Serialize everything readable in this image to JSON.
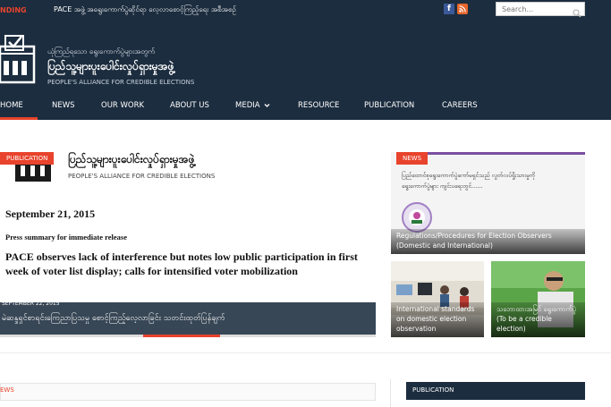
{
  "topbar": {
    "trending_label": "NDING",
    "ticker_text": "PACE အဖွဲ့ အရွေးကောက်ပွဲဆိုင်ရာ လေ့လာစောင့်ကြည့်ရေး အစီအစဉ်",
    "search_placeholder": "Search...",
    "social": [
      "facebook-icon",
      "rss-icon"
    ]
  },
  "header": {
    "logo_line1": "ယုံကြည်ရသော ရွေးကောက်ပွဲများအတွက်",
    "logo_line2": "ပြည်သူ့များပူးပေါင်းလှုပ်ရှားမှုအဖွဲ့",
    "logo_line3": "PEOPLE'S ALLIANCE FOR CREDIBLE ELECTIONS"
  },
  "nav": {
    "items": [
      "HOME",
      "NEWS",
      "OUR WORK",
      "ABOUT US",
      "MEDIA",
      "RESOURCE",
      "PUBLICATION",
      "CAREERS"
    ],
    "media_has_dropdown": true,
    "active": "HOME"
  },
  "feature": {
    "badge": "PUBLICATION",
    "doc_org_mm": "ပြည်သူ့များပူးပေါင်းလှုပ်ရှားမှုအဖွဲ့",
    "doc_org_en": "PEOPLE'S ALLIANCE FOR CREDIBLE ELECTIONS",
    "doc_date": "September 21, 2015",
    "doc_press": "Press summary for immediate release",
    "doc_headline": "PACE observes lack of interference but notes low public participation in first week of voter list display; calls for intensified voter mobilization",
    "date": "SEPTEMBER 22, 2015",
    "caption": "မဲဆန္ဒရှင်စာရင်းကြေညာပြသမှု စောင့်ကြည့်လေ့လာခြင်း သတင်းထုတ်ပြန်ချက်"
  },
  "tiles": {
    "top": {
      "badge": "NEWS",
      "doc_line1": "ပြည်ထောင်စုရွေးကောက်ပွဲကော်မရှင်သည် လွတ်လပ်ရှိုးသားမှုကို",
      "doc_line2": "ရွေးကောက်ပွဲများ ကျင်းပရေးတွင်......",
      "caption": "Regulations/Procedures for Election Observers (Domestic and International)"
    },
    "left": {
      "caption": "International standards on domestic election observation"
    },
    "right": {
      "caption": "သဘောထားအမြင် ရွေးကောက်ပွဲ (To be a credible election)"
    }
  },
  "sections": {
    "news_label": "EWS",
    "publication_label": "PUBLICATION"
  },
  "colors": {
    "navy": "#1c2d3f",
    "accent": "#e8432c"
  }
}
